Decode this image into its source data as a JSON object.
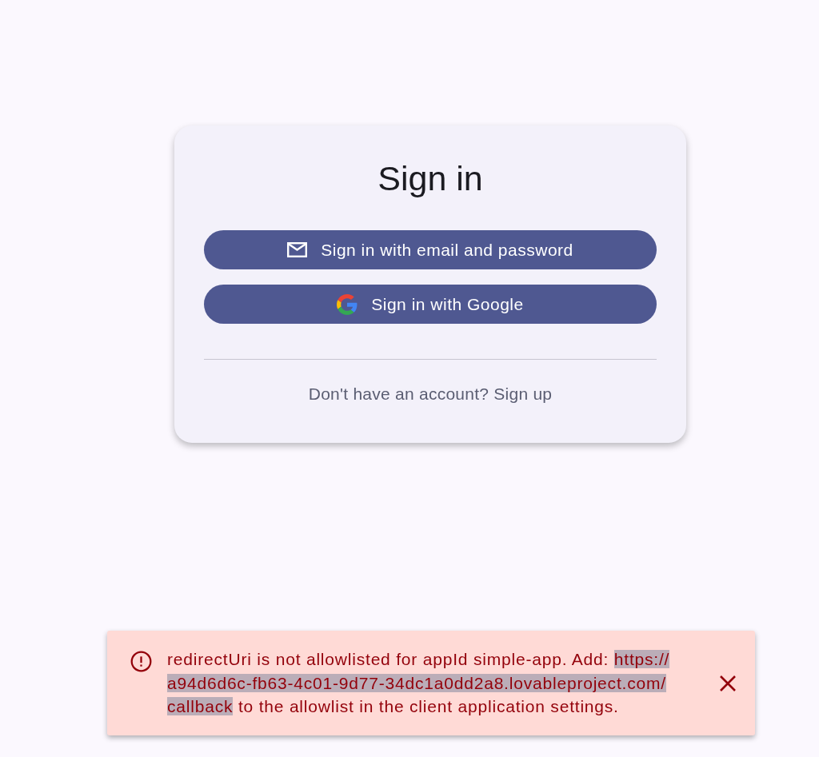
{
  "card": {
    "title": "Sign in",
    "buttons": [
      {
        "kind": "email",
        "label": "Sign in with email and password"
      },
      {
        "kind": "google",
        "label": "Sign in with Google"
      }
    ],
    "footer_link": "Don't have an account? Sign up"
  },
  "error_snackbar": {
    "message": [
      {
        "text": "redirectUri is not allowlisted for appId simple-app. Add: ",
        "selected": false
      },
      {
        "text": "https://a94d6d6c-fb63-4c01-9d77-34dc1a0dd2a8.lovableproject.com/callback",
        "selected": true
      },
      {
        "text": " to the allowlist in the client application settings.",
        "selected": false
      }
    ]
  }
}
